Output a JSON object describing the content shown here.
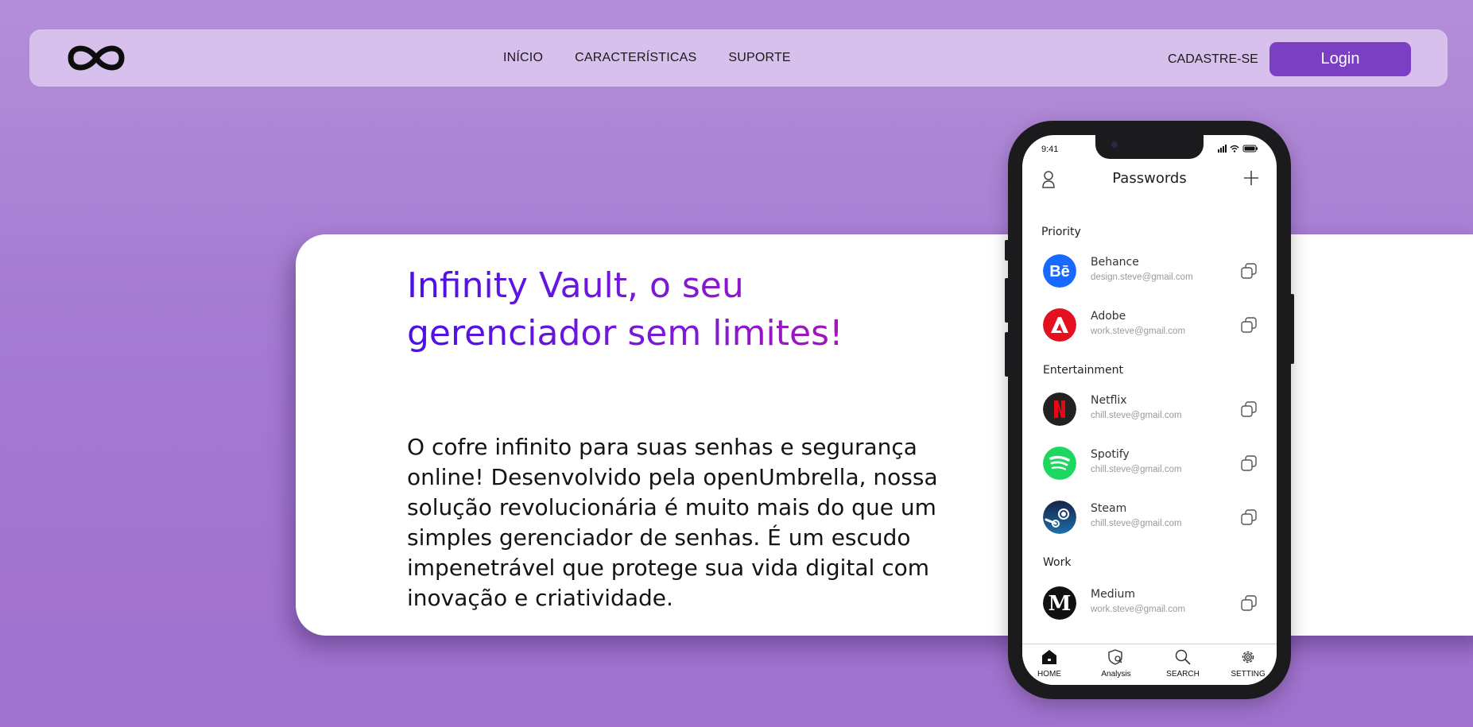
{
  "nav": {
    "links": [
      "INÍCIO",
      "CARACTERÍSTICAS",
      "SUPORTE"
    ],
    "signup": "CADASTRE-SE",
    "login": "Login"
  },
  "hero": {
    "title": "Infinity Vault, o seu gerenciador sem limites!",
    "description": "O cofre infinito para suas senhas e segurança online! Desenvolvido pela openUmbrella, nossa solução revolucionária é muito mais do que um simples gerenciador de senhas. É um escudo impenetrável que protege sua vida digital com inovação e criatividade."
  },
  "phone": {
    "time": "9:41",
    "title": "Passwords",
    "sections": {
      "priority": "Priority",
      "entertainment": "Entertainment",
      "work": "Work"
    },
    "items": [
      {
        "name": "Behance",
        "email": "design.steve@gmail.com",
        "color": "#1769ff"
      },
      {
        "name": "Adobe",
        "email": "work.steve@gmail.com",
        "color": "#e3101f"
      },
      {
        "name": "Netflix",
        "email": "chill.steve@gmail.com",
        "color": "#222222"
      },
      {
        "name": "Spotify",
        "email": "chill.steve@gmail.com",
        "color": "#1ed760"
      },
      {
        "name": "Steam",
        "email": "chill.steve@gmail.com",
        "color": "#1b2b4a"
      },
      {
        "name": "Medium",
        "email": "work.steve@gmail.com",
        "color": "#111111"
      }
    ],
    "tabs": [
      "HOME",
      "Analysis",
      "SEARCH",
      "SETTING"
    ]
  },
  "colors": {
    "accent": "#7a3fc2",
    "navbar": "#d7c0ec",
    "title_gradient_start": "#4a10e6",
    "title_gradient_end": "#a814b8"
  }
}
